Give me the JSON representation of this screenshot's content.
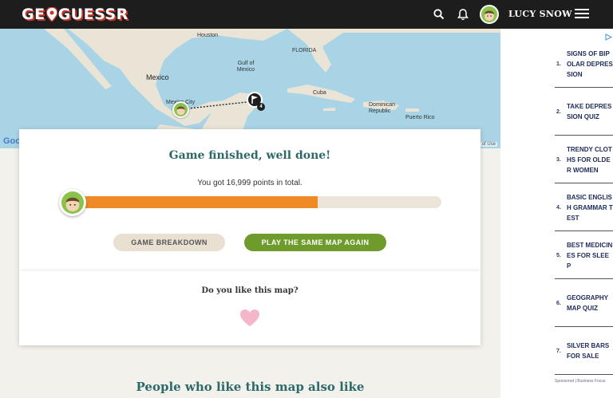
{
  "header": {
    "logo_left": "GE",
    "logo_right": "GUESSR",
    "username": "LUCY SNOW"
  },
  "map": {
    "labels": [
      "Houston",
      "Gulf of Mexico",
      "FLORIDA",
      "Mexico",
      "Mexico City",
      "Cuba",
      "Dominican Republic",
      "Puerto Rico"
    ],
    "round_marker": "4",
    "google": "Google",
    "attribution": "Terms of Use"
  },
  "results": {
    "title": "Game finished, well done!",
    "score_text": "You got 16,999 points in total.",
    "progress_fraction": 0.66,
    "breakdown_label": "GAME BREAKDOWN",
    "play_again_label": "PLAY THE SAME MAP AGAIN"
  },
  "like": {
    "title": "Do you like this map?"
  },
  "section_title": "People who like this map also like",
  "ads": {
    "items": [
      {
        "num": "1.",
        "text": "SIGNS OF BIPOLAR DEPRESSION"
      },
      {
        "num": "2.",
        "text": "TAKE DEPRESSION QUIZ"
      },
      {
        "num": "3.",
        "text": "TRENDY CLOTHS FOR OLDER WOMEN"
      },
      {
        "num": "4.",
        "text": "BASIC ENGLISH GRAMMAR TEST"
      },
      {
        "num": "5.",
        "text": "BEST MEDICINES FOR SLEEP"
      },
      {
        "num": "6.",
        "text": "GEOGRAPHY MAP QUIZ"
      },
      {
        "num": "7.",
        "text": "SILVER BARS FOR SALE"
      }
    ],
    "footer": "Sponsored | Business Focus"
  },
  "colors": {
    "header_bg": "#1d1d1d",
    "title_teal": "#2c6a69",
    "progress_orange": "#ee8b26",
    "play_green": "#6f9b2c",
    "ad_text": "#1d2b5a"
  }
}
